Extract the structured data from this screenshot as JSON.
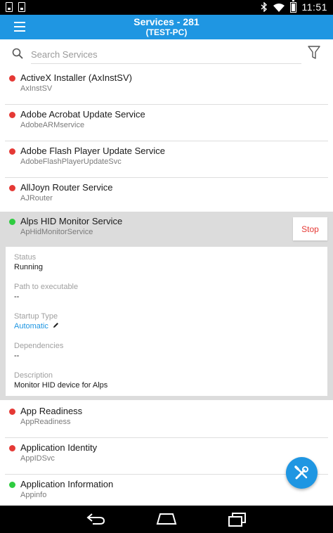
{
  "status_bar": {
    "time": "11:51"
  },
  "app_bar": {
    "title": "Services - 281",
    "subtitle": "(TEST-PC)"
  },
  "search": {
    "placeholder": "Search Services",
    "value": ""
  },
  "services_top": [
    {
      "title": "ActiveX Installer (AxInstSV)",
      "name": "AxInstSV",
      "status_color": "#e53935"
    },
    {
      "title": "Adobe Acrobat Update Service",
      "name": "AdobeARMservice",
      "status_color": "#e53935"
    },
    {
      "title": "Adobe Flash Player Update Service",
      "name": "AdobeFlashPlayerUpdateSvc",
      "status_color": "#e53935"
    },
    {
      "title": "AllJoyn Router Service",
      "name": "AJRouter",
      "status_color": "#e53935"
    }
  ],
  "expanded": {
    "title": "Alps HID Monitor Service",
    "name": "ApHidMonitorService",
    "status_color": "#2ecc40",
    "action_label": "Stop",
    "details": {
      "status_label": "Status",
      "status_value": "Running",
      "path_label": "Path to executable",
      "path_value": "--",
      "startup_label": "Startup Type",
      "startup_value": "Automatic",
      "deps_label": "Dependencies",
      "deps_value": "--",
      "desc_label": "Description",
      "desc_value": "Monitor HID device for Alps"
    }
  },
  "services_bottom": [
    {
      "title": "App Readiness",
      "name": "AppReadiness",
      "status_color": "#e53935"
    },
    {
      "title": "Application Identity",
      "name": "AppIDSvc",
      "status_color": "#e53935"
    },
    {
      "title": "Application Information",
      "name": "Appinfo",
      "status_color": "#2ecc40"
    }
  ],
  "colors": {
    "accent": "#1f96e2",
    "stopped": "#e53935",
    "running": "#2ecc40"
  }
}
